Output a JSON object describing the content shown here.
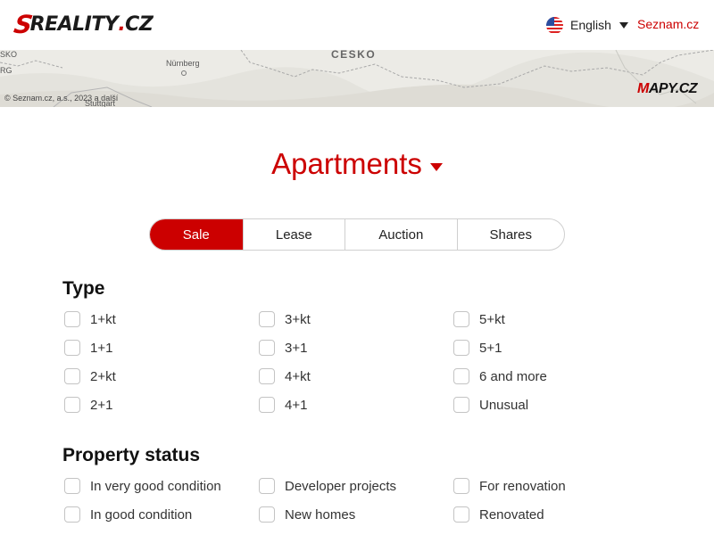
{
  "header": {
    "logo_prefix": "S",
    "logo_main": "REALITY",
    "logo_dot": ".",
    "logo_tld": "CZ",
    "language": "English",
    "partner_link": "Seznam.cz"
  },
  "map": {
    "labels": [
      "SKO",
      "RG",
      "Nürnberg",
      "ČESKO",
      "Stuttgart"
    ],
    "copyright": "© Seznam.cz, a.s., 2023 a další",
    "brand_m": "M",
    "brand_rest": "APY.CZ"
  },
  "page": {
    "title": "Apartments"
  },
  "tabs": [
    {
      "label": "Sale",
      "active": true
    },
    {
      "label": "Lease",
      "active": false
    },
    {
      "label": "Auction",
      "active": false
    },
    {
      "label": "Shares",
      "active": false
    }
  ],
  "type_section": {
    "title": "Type",
    "columns": [
      [
        "1+kt",
        "1+1",
        "2+kt",
        "2+1"
      ],
      [
        "3+kt",
        "3+1",
        "4+kt",
        "4+1"
      ],
      [
        "5+kt",
        "5+1",
        "6 and more",
        "Unusual"
      ]
    ]
  },
  "status_section": {
    "title": "Property status",
    "columns": [
      [
        "In very good condition",
        "In good condition"
      ],
      [
        "Developer projects",
        "New homes"
      ],
      [
        "For renovation",
        "Renovated"
      ]
    ]
  },
  "colors": {
    "accent": "#cc0000",
    "map_bg": "#ecebe6"
  }
}
